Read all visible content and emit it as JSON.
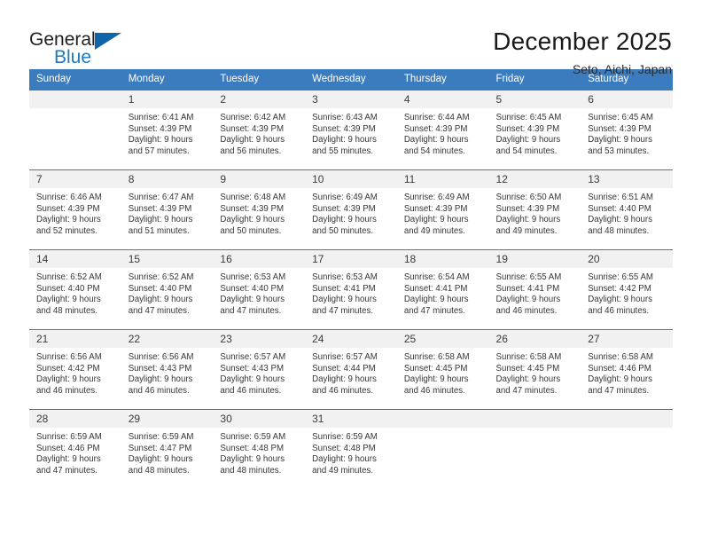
{
  "brand": {
    "name_part1": "General",
    "name_part2": "Blue",
    "accent_color": "#1264a8",
    "blue_text_color": "#1c79c0"
  },
  "header": {
    "title": "December 2025",
    "subtitle": "Seto, Aichi, Japan"
  },
  "theme": {
    "header_row_bg": "#3b7cbf",
    "daynum_bg": "#f1f1f1",
    "cell_bg": "#ffffff",
    "text_color": "#363636"
  },
  "weekday_headers": [
    "Sunday",
    "Monday",
    "Tuesday",
    "Wednesday",
    "Thursday",
    "Friday",
    "Saturday"
  ],
  "weeks": [
    [
      {
        "day": "",
        "sunrise": "",
        "sunset": "",
        "daylight1": "",
        "daylight2": ""
      },
      {
        "day": "1",
        "sunrise": "Sunrise: 6:41 AM",
        "sunset": "Sunset: 4:39 PM",
        "daylight1": "Daylight: 9 hours",
        "daylight2": "and 57 minutes."
      },
      {
        "day": "2",
        "sunrise": "Sunrise: 6:42 AM",
        "sunset": "Sunset: 4:39 PM",
        "daylight1": "Daylight: 9 hours",
        "daylight2": "and 56 minutes."
      },
      {
        "day": "3",
        "sunrise": "Sunrise: 6:43 AM",
        "sunset": "Sunset: 4:39 PM",
        "daylight1": "Daylight: 9 hours",
        "daylight2": "and 55 minutes."
      },
      {
        "day": "4",
        "sunrise": "Sunrise: 6:44 AM",
        "sunset": "Sunset: 4:39 PM",
        "daylight1": "Daylight: 9 hours",
        "daylight2": "and 54 minutes."
      },
      {
        "day": "5",
        "sunrise": "Sunrise: 6:45 AM",
        "sunset": "Sunset: 4:39 PM",
        "daylight1": "Daylight: 9 hours",
        "daylight2": "and 54 minutes."
      },
      {
        "day": "6",
        "sunrise": "Sunrise: 6:45 AM",
        "sunset": "Sunset: 4:39 PM",
        "daylight1": "Daylight: 9 hours",
        "daylight2": "and 53 minutes."
      }
    ],
    [
      {
        "day": "7",
        "sunrise": "Sunrise: 6:46 AM",
        "sunset": "Sunset: 4:39 PM",
        "daylight1": "Daylight: 9 hours",
        "daylight2": "and 52 minutes."
      },
      {
        "day": "8",
        "sunrise": "Sunrise: 6:47 AM",
        "sunset": "Sunset: 4:39 PM",
        "daylight1": "Daylight: 9 hours",
        "daylight2": "and 51 minutes."
      },
      {
        "day": "9",
        "sunrise": "Sunrise: 6:48 AM",
        "sunset": "Sunset: 4:39 PM",
        "daylight1": "Daylight: 9 hours",
        "daylight2": "and 50 minutes."
      },
      {
        "day": "10",
        "sunrise": "Sunrise: 6:49 AM",
        "sunset": "Sunset: 4:39 PM",
        "daylight1": "Daylight: 9 hours",
        "daylight2": "and 50 minutes."
      },
      {
        "day": "11",
        "sunrise": "Sunrise: 6:49 AM",
        "sunset": "Sunset: 4:39 PM",
        "daylight1": "Daylight: 9 hours",
        "daylight2": "and 49 minutes."
      },
      {
        "day": "12",
        "sunrise": "Sunrise: 6:50 AM",
        "sunset": "Sunset: 4:39 PM",
        "daylight1": "Daylight: 9 hours",
        "daylight2": "and 49 minutes."
      },
      {
        "day": "13",
        "sunrise": "Sunrise: 6:51 AM",
        "sunset": "Sunset: 4:40 PM",
        "daylight1": "Daylight: 9 hours",
        "daylight2": "and 48 minutes."
      }
    ],
    [
      {
        "day": "14",
        "sunrise": "Sunrise: 6:52 AM",
        "sunset": "Sunset: 4:40 PM",
        "daylight1": "Daylight: 9 hours",
        "daylight2": "and 48 minutes."
      },
      {
        "day": "15",
        "sunrise": "Sunrise: 6:52 AM",
        "sunset": "Sunset: 4:40 PM",
        "daylight1": "Daylight: 9 hours",
        "daylight2": "and 47 minutes."
      },
      {
        "day": "16",
        "sunrise": "Sunrise: 6:53 AM",
        "sunset": "Sunset: 4:40 PM",
        "daylight1": "Daylight: 9 hours",
        "daylight2": "and 47 minutes."
      },
      {
        "day": "17",
        "sunrise": "Sunrise: 6:53 AM",
        "sunset": "Sunset: 4:41 PM",
        "daylight1": "Daylight: 9 hours",
        "daylight2": "and 47 minutes."
      },
      {
        "day": "18",
        "sunrise": "Sunrise: 6:54 AM",
        "sunset": "Sunset: 4:41 PM",
        "daylight1": "Daylight: 9 hours",
        "daylight2": "and 47 minutes."
      },
      {
        "day": "19",
        "sunrise": "Sunrise: 6:55 AM",
        "sunset": "Sunset: 4:41 PM",
        "daylight1": "Daylight: 9 hours",
        "daylight2": "and 46 minutes."
      },
      {
        "day": "20",
        "sunrise": "Sunrise: 6:55 AM",
        "sunset": "Sunset: 4:42 PM",
        "daylight1": "Daylight: 9 hours",
        "daylight2": "and 46 minutes."
      }
    ],
    [
      {
        "day": "21",
        "sunrise": "Sunrise: 6:56 AM",
        "sunset": "Sunset: 4:42 PM",
        "daylight1": "Daylight: 9 hours",
        "daylight2": "and 46 minutes."
      },
      {
        "day": "22",
        "sunrise": "Sunrise: 6:56 AM",
        "sunset": "Sunset: 4:43 PM",
        "daylight1": "Daylight: 9 hours",
        "daylight2": "and 46 minutes."
      },
      {
        "day": "23",
        "sunrise": "Sunrise: 6:57 AM",
        "sunset": "Sunset: 4:43 PM",
        "daylight1": "Daylight: 9 hours",
        "daylight2": "and 46 minutes."
      },
      {
        "day": "24",
        "sunrise": "Sunrise: 6:57 AM",
        "sunset": "Sunset: 4:44 PM",
        "daylight1": "Daylight: 9 hours",
        "daylight2": "and 46 minutes."
      },
      {
        "day": "25",
        "sunrise": "Sunrise: 6:58 AM",
        "sunset": "Sunset: 4:45 PM",
        "daylight1": "Daylight: 9 hours",
        "daylight2": "and 46 minutes."
      },
      {
        "day": "26",
        "sunrise": "Sunrise: 6:58 AM",
        "sunset": "Sunset: 4:45 PM",
        "daylight1": "Daylight: 9 hours",
        "daylight2": "and 47 minutes."
      },
      {
        "day": "27",
        "sunrise": "Sunrise: 6:58 AM",
        "sunset": "Sunset: 4:46 PM",
        "daylight1": "Daylight: 9 hours",
        "daylight2": "and 47 minutes."
      }
    ],
    [
      {
        "day": "28",
        "sunrise": "Sunrise: 6:59 AM",
        "sunset": "Sunset: 4:46 PM",
        "daylight1": "Daylight: 9 hours",
        "daylight2": "and 47 minutes."
      },
      {
        "day": "29",
        "sunrise": "Sunrise: 6:59 AM",
        "sunset": "Sunset: 4:47 PM",
        "daylight1": "Daylight: 9 hours",
        "daylight2": "and 48 minutes."
      },
      {
        "day": "30",
        "sunrise": "Sunrise: 6:59 AM",
        "sunset": "Sunset: 4:48 PM",
        "daylight1": "Daylight: 9 hours",
        "daylight2": "and 48 minutes."
      },
      {
        "day": "31",
        "sunrise": "Sunrise: 6:59 AM",
        "sunset": "Sunset: 4:48 PM",
        "daylight1": "Daylight: 9 hours",
        "daylight2": "and 49 minutes."
      },
      {
        "day": "",
        "sunrise": "",
        "sunset": "",
        "daylight1": "",
        "daylight2": ""
      },
      {
        "day": "",
        "sunrise": "",
        "sunset": "",
        "daylight1": "",
        "daylight2": ""
      },
      {
        "day": "",
        "sunrise": "",
        "sunset": "",
        "daylight1": "",
        "daylight2": ""
      }
    ]
  ]
}
